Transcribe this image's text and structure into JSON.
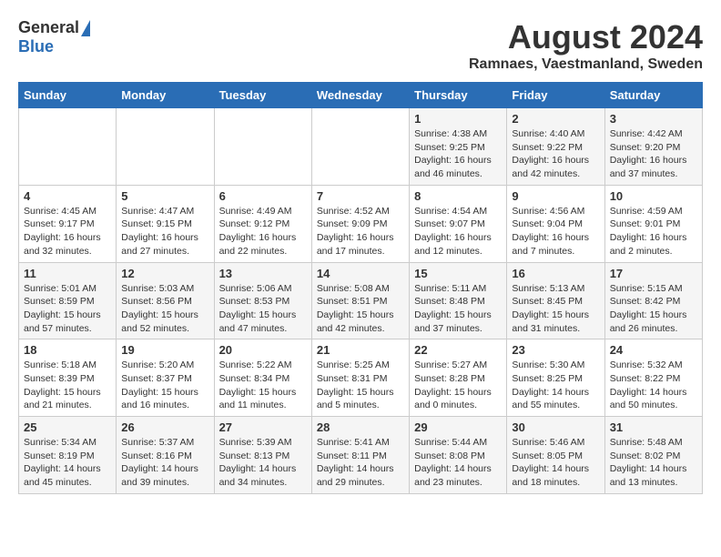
{
  "header": {
    "logo_general": "General",
    "logo_blue": "Blue",
    "month_title": "August 2024",
    "location": "Ramnaes, Vaestmanland, Sweden"
  },
  "weekdays": [
    "Sunday",
    "Monday",
    "Tuesday",
    "Wednesday",
    "Thursday",
    "Friday",
    "Saturday"
  ],
  "weeks": [
    [
      {
        "day": "",
        "info": ""
      },
      {
        "day": "",
        "info": ""
      },
      {
        "day": "",
        "info": ""
      },
      {
        "day": "",
        "info": ""
      },
      {
        "day": "1",
        "info": "Sunrise: 4:38 AM\nSunset: 9:25 PM\nDaylight: 16 hours\nand 46 minutes."
      },
      {
        "day": "2",
        "info": "Sunrise: 4:40 AM\nSunset: 9:22 PM\nDaylight: 16 hours\nand 42 minutes."
      },
      {
        "day": "3",
        "info": "Sunrise: 4:42 AM\nSunset: 9:20 PM\nDaylight: 16 hours\nand 37 minutes."
      }
    ],
    [
      {
        "day": "4",
        "info": "Sunrise: 4:45 AM\nSunset: 9:17 PM\nDaylight: 16 hours\nand 32 minutes."
      },
      {
        "day": "5",
        "info": "Sunrise: 4:47 AM\nSunset: 9:15 PM\nDaylight: 16 hours\nand 27 minutes."
      },
      {
        "day": "6",
        "info": "Sunrise: 4:49 AM\nSunset: 9:12 PM\nDaylight: 16 hours\nand 22 minutes."
      },
      {
        "day": "7",
        "info": "Sunrise: 4:52 AM\nSunset: 9:09 PM\nDaylight: 16 hours\nand 17 minutes."
      },
      {
        "day": "8",
        "info": "Sunrise: 4:54 AM\nSunset: 9:07 PM\nDaylight: 16 hours\nand 12 minutes."
      },
      {
        "day": "9",
        "info": "Sunrise: 4:56 AM\nSunset: 9:04 PM\nDaylight: 16 hours\nand 7 minutes."
      },
      {
        "day": "10",
        "info": "Sunrise: 4:59 AM\nSunset: 9:01 PM\nDaylight: 16 hours\nand 2 minutes."
      }
    ],
    [
      {
        "day": "11",
        "info": "Sunrise: 5:01 AM\nSunset: 8:59 PM\nDaylight: 15 hours\nand 57 minutes."
      },
      {
        "day": "12",
        "info": "Sunrise: 5:03 AM\nSunset: 8:56 PM\nDaylight: 15 hours\nand 52 minutes."
      },
      {
        "day": "13",
        "info": "Sunrise: 5:06 AM\nSunset: 8:53 PM\nDaylight: 15 hours\nand 47 minutes."
      },
      {
        "day": "14",
        "info": "Sunrise: 5:08 AM\nSunset: 8:51 PM\nDaylight: 15 hours\nand 42 minutes."
      },
      {
        "day": "15",
        "info": "Sunrise: 5:11 AM\nSunset: 8:48 PM\nDaylight: 15 hours\nand 37 minutes."
      },
      {
        "day": "16",
        "info": "Sunrise: 5:13 AM\nSunset: 8:45 PM\nDaylight: 15 hours\nand 31 minutes."
      },
      {
        "day": "17",
        "info": "Sunrise: 5:15 AM\nSunset: 8:42 PM\nDaylight: 15 hours\nand 26 minutes."
      }
    ],
    [
      {
        "day": "18",
        "info": "Sunrise: 5:18 AM\nSunset: 8:39 PM\nDaylight: 15 hours\nand 21 minutes."
      },
      {
        "day": "19",
        "info": "Sunrise: 5:20 AM\nSunset: 8:37 PM\nDaylight: 15 hours\nand 16 minutes."
      },
      {
        "day": "20",
        "info": "Sunrise: 5:22 AM\nSunset: 8:34 PM\nDaylight: 15 hours\nand 11 minutes."
      },
      {
        "day": "21",
        "info": "Sunrise: 5:25 AM\nSunset: 8:31 PM\nDaylight: 15 hours\nand 5 minutes."
      },
      {
        "day": "22",
        "info": "Sunrise: 5:27 AM\nSunset: 8:28 PM\nDaylight: 15 hours\nand 0 minutes."
      },
      {
        "day": "23",
        "info": "Sunrise: 5:30 AM\nSunset: 8:25 PM\nDaylight: 14 hours\nand 55 minutes."
      },
      {
        "day": "24",
        "info": "Sunrise: 5:32 AM\nSunset: 8:22 PM\nDaylight: 14 hours\nand 50 minutes."
      }
    ],
    [
      {
        "day": "25",
        "info": "Sunrise: 5:34 AM\nSunset: 8:19 PM\nDaylight: 14 hours\nand 45 minutes."
      },
      {
        "day": "26",
        "info": "Sunrise: 5:37 AM\nSunset: 8:16 PM\nDaylight: 14 hours\nand 39 minutes."
      },
      {
        "day": "27",
        "info": "Sunrise: 5:39 AM\nSunset: 8:13 PM\nDaylight: 14 hours\nand 34 minutes."
      },
      {
        "day": "28",
        "info": "Sunrise: 5:41 AM\nSunset: 8:11 PM\nDaylight: 14 hours\nand 29 minutes."
      },
      {
        "day": "29",
        "info": "Sunrise: 5:44 AM\nSunset: 8:08 PM\nDaylight: 14 hours\nand 23 minutes."
      },
      {
        "day": "30",
        "info": "Sunrise: 5:46 AM\nSunset: 8:05 PM\nDaylight: 14 hours\nand 18 minutes."
      },
      {
        "day": "31",
        "info": "Sunrise: 5:48 AM\nSunset: 8:02 PM\nDaylight: 14 hours\nand 13 minutes."
      }
    ]
  ]
}
